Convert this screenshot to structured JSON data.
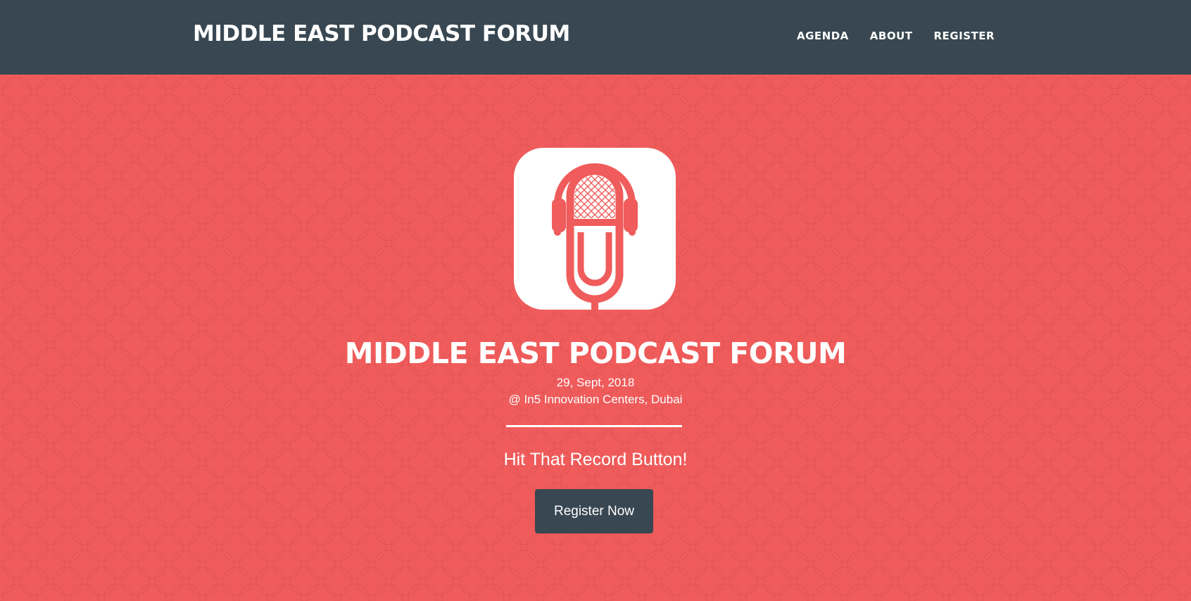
{
  "navbar": {
    "brand": "MIDDLE EAST PODCAST FORUM",
    "links": [
      "AGENDA",
      "ABOUT",
      "REGISTER"
    ]
  },
  "hero": {
    "logo_icon": "podcast-microphone-icon",
    "title": "MIDDLE EAST PODCAST FORUM",
    "date": "29, Sept, 2018",
    "venue": "@ In5 Innovation Centers, Dubai",
    "tagline": "Hit That Record Button!",
    "cta_label": "Register Now"
  },
  "colors": {
    "navbar_bg": "#384751",
    "hero_bg": "#ef5c5b",
    "button_bg": "#384751",
    "text": "#ffffff"
  }
}
